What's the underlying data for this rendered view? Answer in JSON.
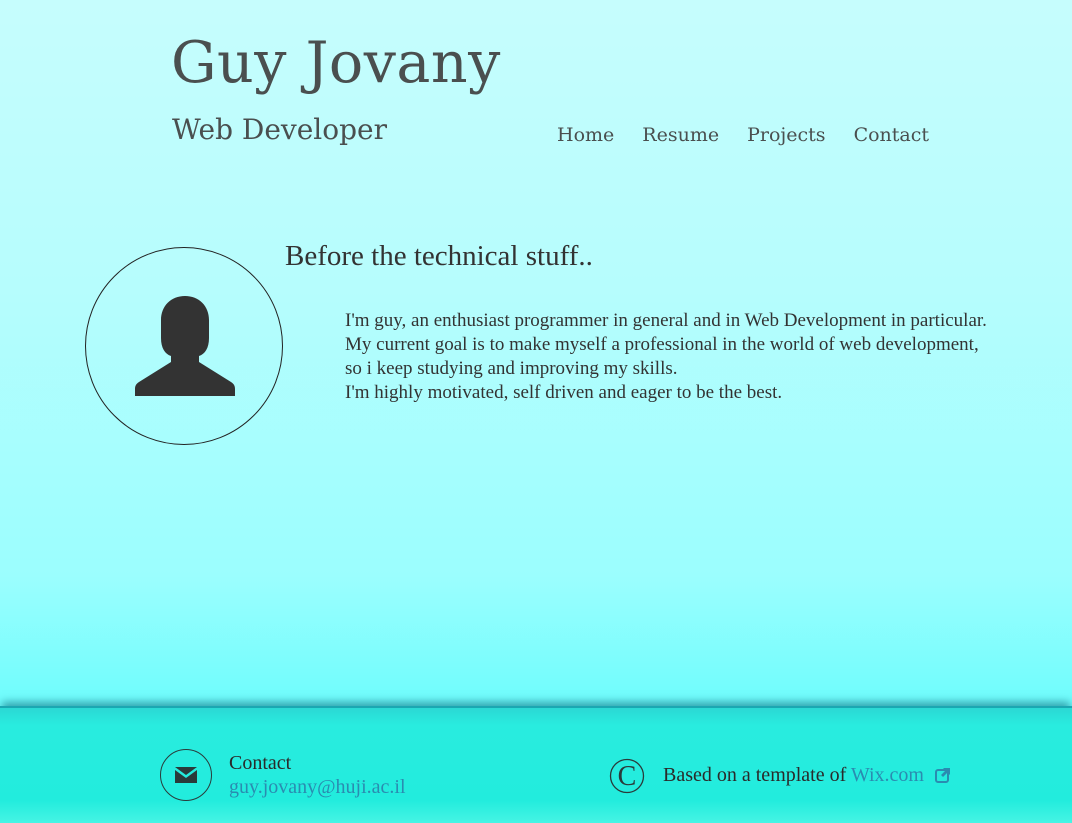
{
  "header": {
    "name": "Guy Jovany",
    "subtitle": "Web Developer"
  },
  "nav": {
    "items": [
      {
        "label": "Home"
      },
      {
        "label": "Resume"
      },
      {
        "label": "Projects"
      },
      {
        "label": "Contact"
      }
    ]
  },
  "about": {
    "heading": "Before the technical stuff..",
    "lines": [
      "I'm guy, an enthusiast programmer in general and in Web Development in particular.",
      "My current goal is to make myself a professional in the world of web development,",
      "so i keep studying and improving my skills.",
      "I'm highly motivated, self driven and eager to be the best."
    ],
    "avatar_icon": "user-silhouette-icon"
  },
  "footer": {
    "contact_label": "Contact",
    "contact_email": "guy.jovany@huji.ac.il",
    "template_prefix": "Based on a template of",
    "template_link": "Wix.com",
    "icons": [
      "envelope-icon",
      "copyright-icon",
      "external-link-icon"
    ]
  },
  "colors": {
    "text": "#4a4f4f",
    "link": "#2a8cb0",
    "background_top": "#c6fdfd",
    "background_bottom": "#4af6f6",
    "footer": "#22ecdd"
  }
}
